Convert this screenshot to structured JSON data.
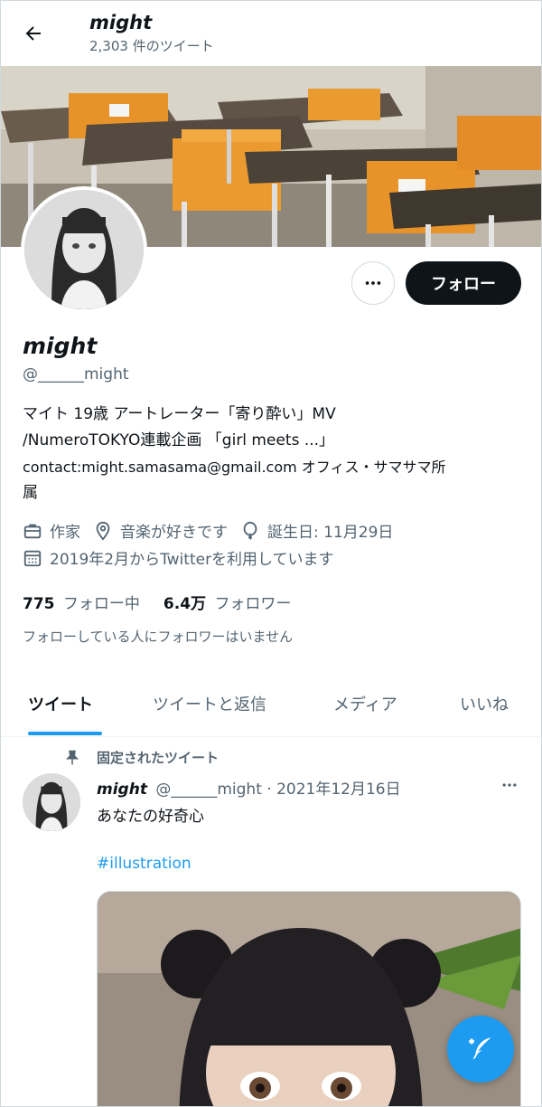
{
  "header": {
    "title": "might",
    "tweet_count": "2,303 件のツイート"
  },
  "profile": {
    "name": "might",
    "handle": "@______might",
    "bio_lines": [
      "マイト 19歳 アートレーター「寄り酔い」MV",
      "/NumeroTOKYO連載企画 「girl meets ...」",
      "contact:might.samasama@gmail.com オフィス・サマサマ所",
      "属"
    ],
    "occupation": "作家",
    "location": "音楽が好きです",
    "birthday": "誕生日: 11月29日",
    "joined": "2019年2月からTwitterを利用しています",
    "following_count": "775",
    "following_label": "フォロー中",
    "followers_count": "6.4万",
    "followers_label": "フォロワー",
    "mutual_note": "フォローしている人にフォロワーはいません"
  },
  "actions": {
    "follow_label": "フォロー"
  },
  "tabs": [
    {
      "label": "ツイート",
      "active": true
    },
    {
      "label": "ツイートと返信",
      "active": false
    },
    {
      "label": "メディア",
      "active": false
    },
    {
      "label": "いいね",
      "active": false
    }
  ],
  "pinned_tweet": {
    "pinned_label": "固定されたツイート",
    "author_name": "might",
    "author_handle": "@______might",
    "date": "· 2021年12月16日",
    "text": "あなたの好奇心",
    "hashtag": "#illustration"
  },
  "colors": {
    "accent": "#1d9bf0",
    "text_primary": "#0f1419",
    "text_secondary": "#536471",
    "follow_button_bg": "#0f1419"
  },
  "icons": {
    "back": "arrow-left-icon",
    "more": "more-horizontal-icon",
    "occupation": "briefcase-icon",
    "location": "location-pin-icon",
    "birthday": "balloon-icon",
    "joined": "calendar-icon",
    "pin": "pin-icon",
    "compose": "compose-tweet-icon"
  }
}
